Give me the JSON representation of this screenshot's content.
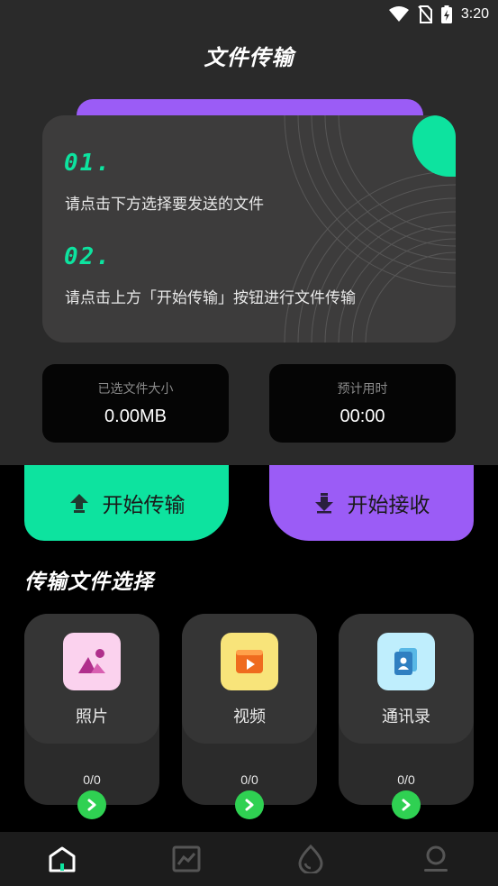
{
  "status_bar": {
    "time": "3:20"
  },
  "header": {
    "title": "文件传输"
  },
  "guide": {
    "steps": [
      {
        "num": "01.",
        "text": "请点击下方选择要发送的文件"
      },
      {
        "num": "02.",
        "text": "请点击上方「开始传输」按钮进行文件传输"
      }
    ]
  },
  "stats": {
    "size_label": "已选文件大小",
    "size_value": "0.00MB",
    "time_label": "预计用时",
    "time_value": "00:00"
  },
  "actions": {
    "send_label": "开始传输",
    "receive_label": "开始接收"
  },
  "selection": {
    "title": "传输文件选择",
    "tiles": [
      {
        "name": "照片",
        "count": "0/0",
        "icon": "photo-icon"
      },
      {
        "name": "视频",
        "count": "0/0",
        "icon": "video-icon"
      },
      {
        "name": "通讯录",
        "count": "0/0",
        "icon": "contacts-icon"
      }
    ]
  },
  "colors": {
    "accent_green": "#0de39f",
    "accent_purple": "#9b5cf6",
    "arrow_green": "#2fd152"
  }
}
